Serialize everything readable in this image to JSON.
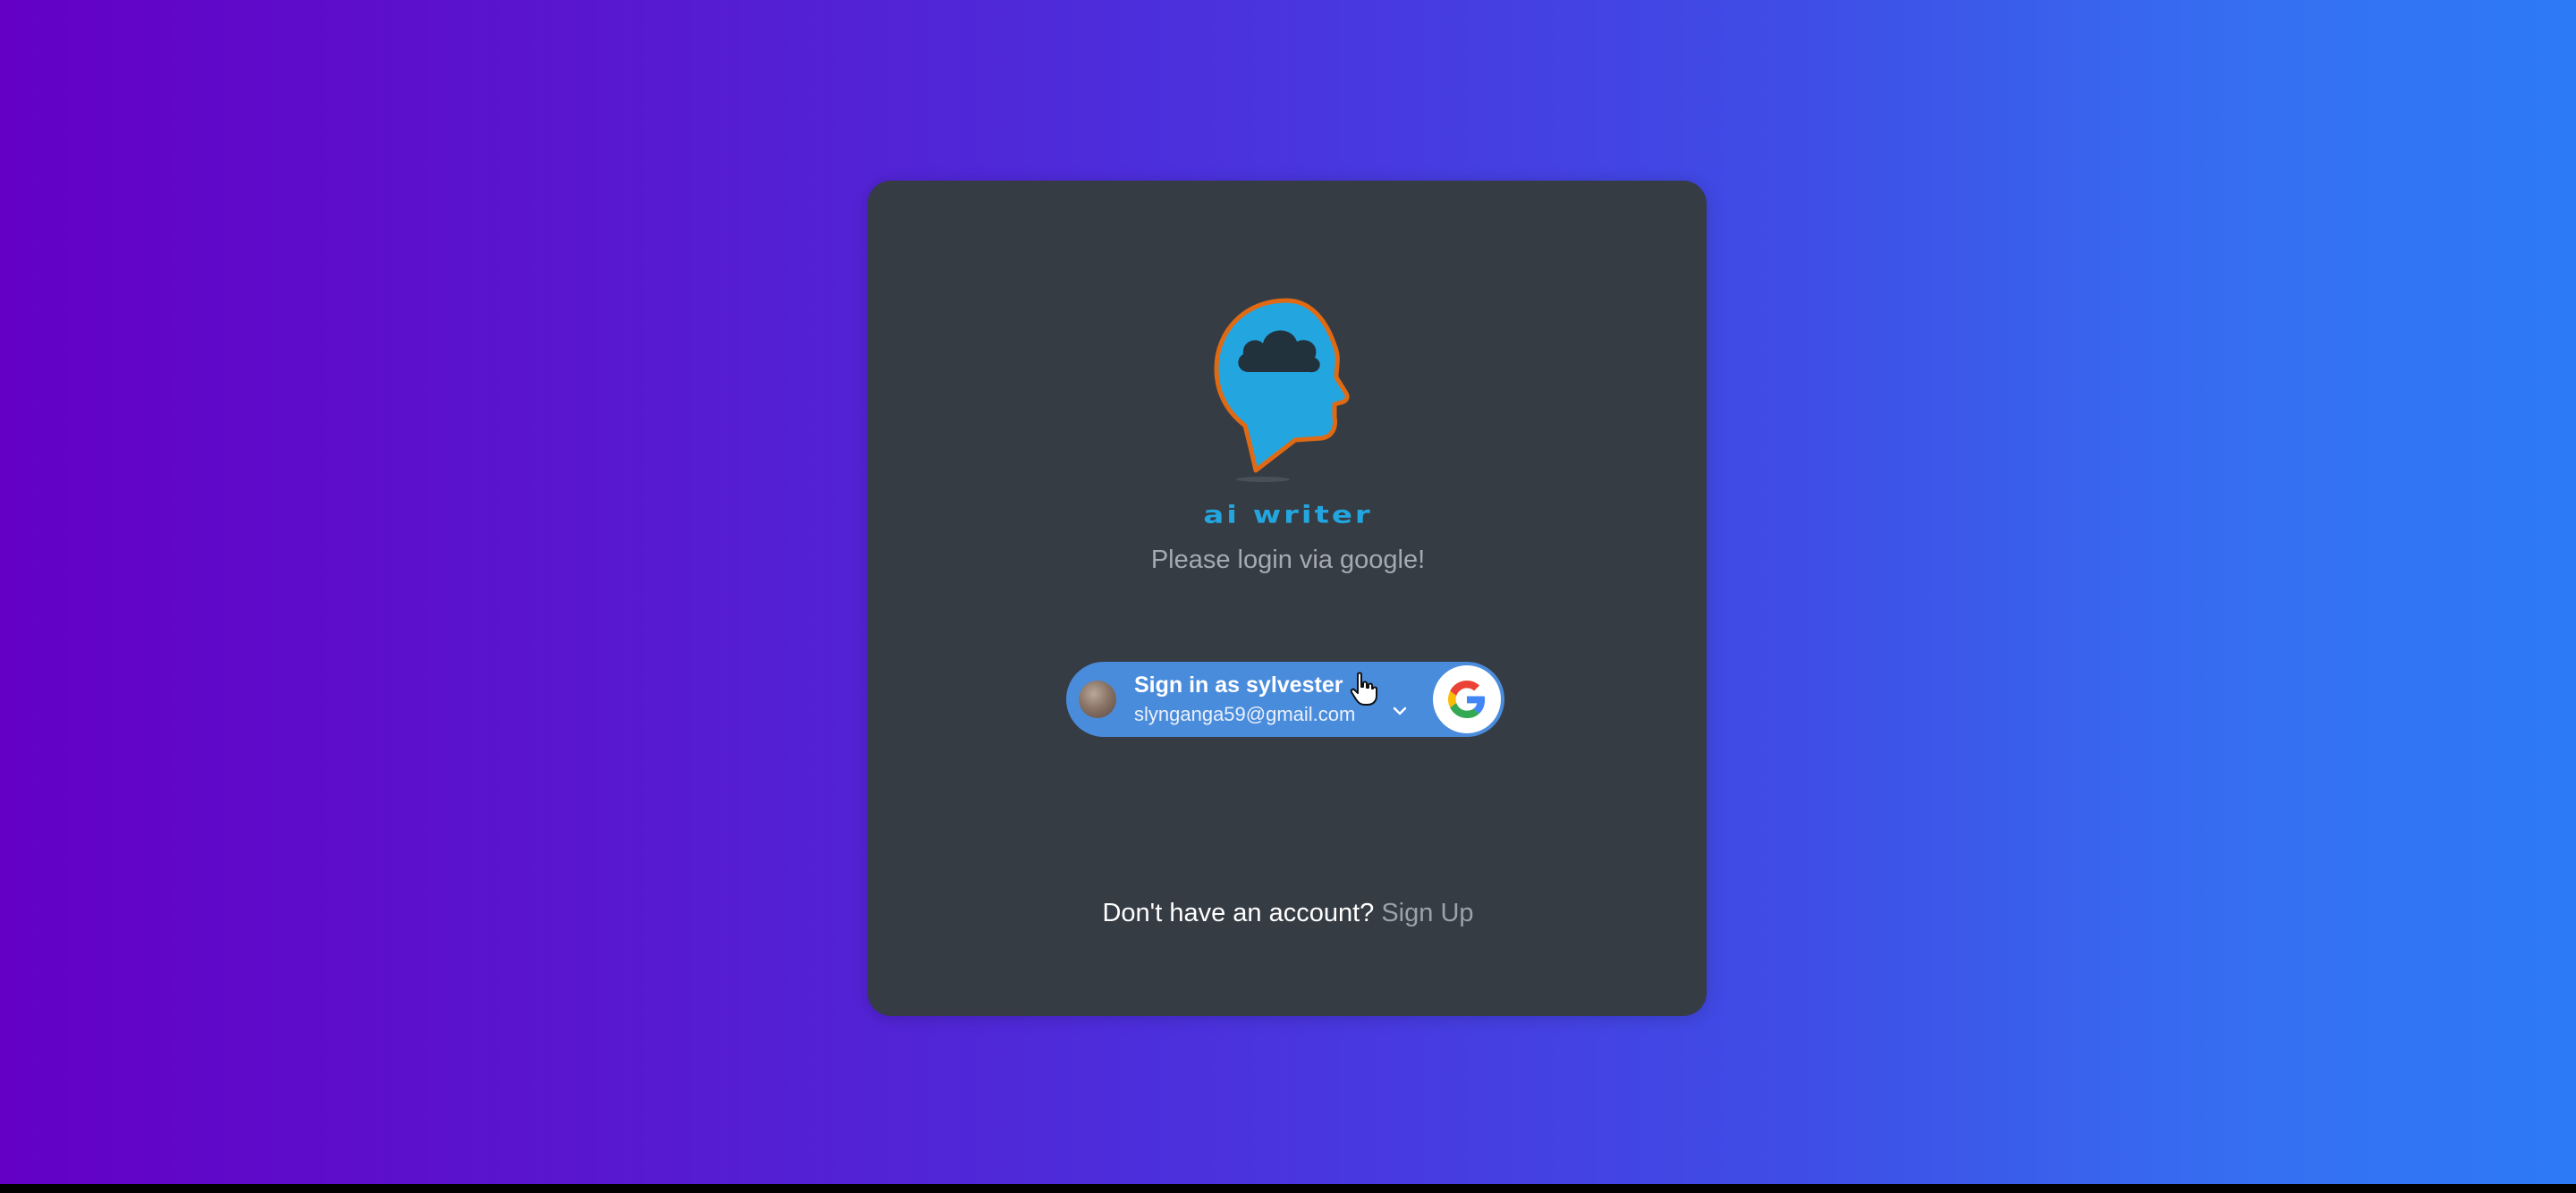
{
  "app": {
    "brand_name": "ai writer",
    "subtitle": "Please login via google!"
  },
  "google_button": {
    "name_line": "Sign in as sylvester",
    "email": "slynganga59@gmail.com",
    "logo_icon": "google-g-icon",
    "chevron_icon": "chevron-down-icon",
    "background_color": "#4a8cdc"
  },
  "signup": {
    "prompt": "Don't have an account?",
    "link_label": "Sign Up"
  },
  "colors": {
    "gradient_start": "#6400c6",
    "gradient_end": "#2d7af6",
    "card": "#363c44",
    "brand": "#23a6e0",
    "logo_outline": "#e06a14"
  }
}
